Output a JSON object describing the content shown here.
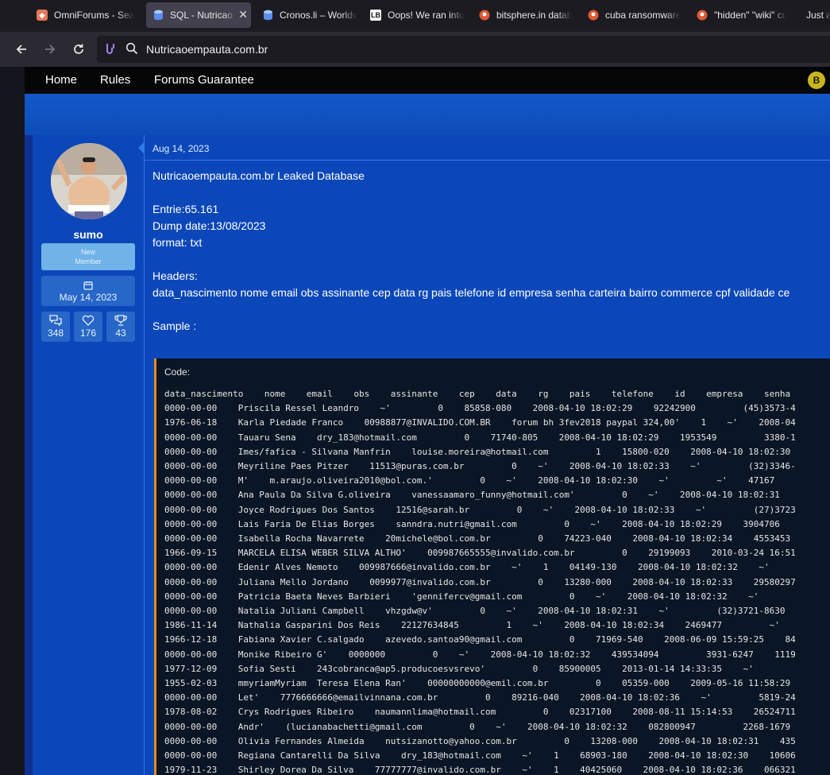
{
  "browser": {
    "tabs": [
      {
        "label": "OmniForums - Sea",
        "icon": "omniforums-icon",
        "active": false
      },
      {
        "label": "SQL - Nutricao",
        "icon": "database-icon",
        "active": true
      },
      {
        "label": "Cronos.li – Worldv",
        "icon": "database-icon",
        "active": false
      },
      {
        "label": "Oops! We ran into",
        "icon": "lb-icon",
        "active": false
      },
      {
        "label": "bitsphere.in datab",
        "icon": "duckduckgo-icon",
        "active": false
      },
      {
        "label": "cuba ransomware",
        "icon": "duckduckgo-icon",
        "active": false
      },
      {
        "label": "\"hidden\" \"wiki\" cu",
        "icon": "duckduckgo-icon",
        "active": false
      },
      {
        "label": "Just a",
        "icon": "",
        "active": false
      }
    ],
    "close_glyph": "✕",
    "url": "Nutricaoempauta.com.br"
  },
  "site_nav": {
    "home": "Home",
    "rules": "Rules",
    "forums_guarantee": "Forums Guarantee",
    "user_badge": "B"
  },
  "author": {
    "username": "sumo",
    "rank_line1": "New",
    "rank_line2": "Member",
    "joined": "May 14, 2023",
    "stats": {
      "messages": "348",
      "reactions": "176",
      "points": "43"
    }
  },
  "post": {
    "date": "Aug 14, 2023",
    "title": "Nutricaoempauta.com.br Leaked Database",
    "entries": "Entrie:65.161",
    "dump_date": "Dump date:13/08/2023",
    "format": "format: txt",
    "headers_label": "Headers:",
    "headers": "data_nascimento nome email obs assinante cep data rg pais telefone id empresa senha carteira bairro commerce cpf validade ce",
    "sample_label": "Sample :",
    "code_title": "Code:",
    "code_lines": [
      "data_nascimento    nome    email    obs    assinante    cep    data    rg    pais    telefone    id    empresa    senha",
      "0000-00-00    Priscila Ressel Leandro    ~'         0    85858-080    2008-04-10 18:02:29    92242900         (45)3573-4",
      "1976-06-18    Karla Piedade Franco    00988877@INVALIDO.COM.BR    forum bh 3fev2018 paypal 324,00'    1    ~'    2008-04",
      "0000-00-00    Tauaru Sena    dry_183@hotmail.com         0    71740-805    2008-04-10 18:02:29    1953549         3380-1",
      "0000-00-00    Imes/fafica - Silvana Manfrin    louise.moreira@hotmail.com         1    15800-020    2008-04-10 18:02:30",
      "0000-00-00    Meyriline Paes Pitzer    11513@puras.com.br         0    ~'    2008-04-10 18:02:33    ~'         (32)3346-",
      "0000-00-00    M'    m.araujo.oliveira2010@bol.com.'         0    ~'    2008-04-10 18:02:30    ~'         ~'    47167",
      "0000-00-00    Ana Paula Da Silva G.oliveira    vanessaamaro_funny@hotmail.com'         0    ~'    2008-04-10 18:02:31",
      "0000-00-00    Joyce Rodrigues Dos Santos    12516@sarah.br         0    ~'    2008-04-10 18:02:33    ~'         (27)3723",
      "0000-00-00    Lais Faria De Elias Borges    sanndra.nutri@gmail.com         0    ~'    2008-04-10 18:02:29    3904706",
      "0000-00-00    Isabella Rocha Navarrete    20michele@bol.com.br         0    74223-040    2008-04-10 18:02:34    4553453",
      "1966-09-15    MARCELA ELISA WEBER SILVA ALTHO'    009987665555@invalido.com.br         0    29199093    2010-03-24 16:51",
      "0000-00-00    Edenir Alves Nemoto    009987666@invalido.com.br    ~'    1    04149-130    2008-04-10 18:02:32    ~'",
      "0000-00-00    Juliana Mello Jordano    0099977@invalido.com.br         0    13280-000    2008-04-10 18:02:33    29580297",
      "0000-00-00    Patricia Baeta Neves Barbieri    'gennifercv@gmail.com         0    ~'    2008-04-10 18:02:32    ~'",
      "0000-00-00    Natalia Juliani Campbell    vhzgdw@v'         0    ~'    2008-04-10 18:02:31    ~'         (32)3721-8630",
      "1986-11-14    Nathalia Gasparini Dos Reis    22127634845         1    ~'    2008-04-10 18:02:34    2469477         ~'",
      "1966-12-18    Fabiana Xavier C.salgado    azevedo.santoa90@gmail.com         0    71969-540    2008-06-09 15:59:25    84",
      "0000-00-00    Monike Ribeiro G'    0000000         0    ~'    2008-04-10 18:02:32    439534094         3931-6247    1119",
      "1977-12-09    Sofia Sesti    243cobranca@ap5.producoesvsrevo'         0    85900005    2013-01-14 14:33:35    ~'",
      "1955-02-03    mmyriamMyriam  Teresa Elena Ran'    00000000000@emil.com.br         0    05359-000    2009-05-16 11:58:29",
      "0000-00-00    Let'    7776666666@emailvinnana.com.br         0    89216-040    2008-04-10 18:02:36    ~'         5819-24",
      "1978-08-02    Crys Rodrigues Ribeiro    naumannlima@hotmail.com         0    02317100    2008-08-11 15:14:53    26524711",
      "0000-00-00    Andr'    (lucianabachetti@gmail.com         0    ~'    2008-04-10 18:02:32    082800947         2268-1679",
      "0000-00-00    Olivia Fernandes Almeida    nutsizanotto@yahoo.com.br         0    13208-000    2008-04-10 18:02:31    435",
      "0000-00-00    Regiana Cantarelli Da Silva    dry_183@hotmail.com    ~'    1    68903-180    2008-04-10 18:02:30    10606",
      "1979-11-23    Shirley Dorea Da Silva    77777777@invalido.com.br    ~'    1    40425060    2008-04-10 18:02:36    066321"
    ]
  }
}
